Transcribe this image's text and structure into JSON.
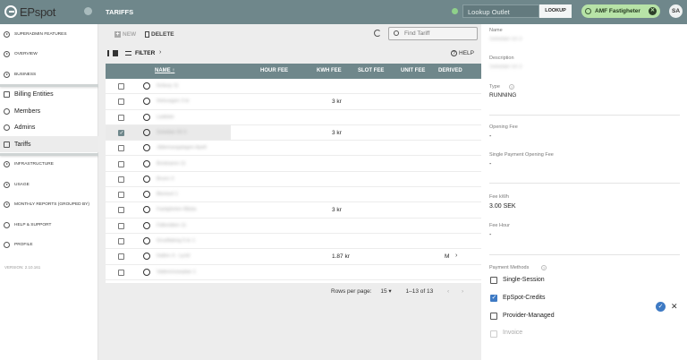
{
  "brand": {
    "name": "EPspot"
  },
  "header": {
    "page_title": "TARIFFS",
    "lookup_placeholder": "Lookup Outlet",
    "lookup_button": "LOOKUP",
    "outlet_chip": "AMF Fastigheter",
    "avatar": "SA"
  },
  "sidebar": {
    "superadmin": "SUPERADMIN FEATURES",
    "overview": "OVERVIEW",
    "business": "BUSINESS",
    "billing": "Billing Entities",
    "members": "Members",
    "admins": "Admins",
    "tariffs": "Tariffs",
    "infrastructure": "INFRASTRUCTURE",
    "usage": "USAGE",
    "monthly": "MONTHLY REPORTS (GROUPED BY)",
    "help": "HELP & SUPPORT",
    "profile": "PROFILE",
    "version": "VERSION: 2.10.161"
  },
  "toolbar": {
    "new": "NEW",
    "delete": "DELETE",
    "search_placeholder": "Find Tariff",
    "filter": "FILTER",
    "help": "HELP"
  },
  "table": {
    "headers": {
      "name": "NAME",
      "hour_fee": "HOUR FEE",
      "kwh_fee": "KWH FEE",
      "slot_fee": "SLOT FEE",
      "unit_fee": "UNIT FEE",
      "derived": "DERIVED"
    },
    "rows": [
      {
        "name": "Grävsy 11",
        "kwh": "",
        "derived": "",
        "selected": false
      },
      {
        "name": "Helsvagen 3 kr",
        "kwh": "3 kr",
        "derived": "",
        "selected": false
      },
      {
        "name": "Laddstn",
        "kwh": "",
        "derived": "",
        "selected": false
      },
      {
        "name": "Solsidan 03 3",
        "kwh": "3 kr",
        "derived": "",
        "selected": true
      },
      {
        "name": "Jättemangalagen Apell",
        "kwh": "",
        "derived": "",
        "selected": false
      },
      {
        "name": "Bredvaren 11",
        "kwh": "",
        "derived": "",
        "selected": false
      },
      {
        "name": "Brunn 3",
        "kwh": "",
        "derived": "",
        "selected": false
      },
      {
        "name": "Blomsvl 1",
        "kwh": "",
        "derived": "",
        "selected": false
      },
      {
        "name": "Fastigheten Båsta",
        "kwh": "3 kr",
        "derived": "",
        "selected": false
      },
      {
        "name": "Fällorätten 11",
        "kwh": "",
        "derived": "",
        "selected": false
      },
      {
        "name": "Grusflaking 5 kr 1",
        "kwh": "",
        "derived": "",
        "selected": false
      },
      {
        "name": "Hallen 4 - Lyckl",
        "kwh": "1.87 kr",
        "derived": "M",
        "selected": false
      },
      {
        "name": "Vattenmoseplan 1",
        "kwh": "",
        "derived": "",
        "selected": false
      }
    ]
  },
  "pager": {
    "rows_label": "Rows per page:",
    "rows_value": "15",
    "range": "1–13 of 13"
  },
  "detail": {
    "name_label": "Name",
    "name_value": "Solsidan 03 3",
    "desc_label": "Description",
    "desc_value": "Solsidan 03 3",
    "type_label": "Type",
    "type_value": "RUNNING",
    "opening_label": "Opening Fee",
    "opening_value": "-",
    "single_opening_label": "Single Payment Opening Fee",
    "single_opening_value": "-",
    "kwh_label": "Fee kWh",
    "kwh_value": "3.00 SEK",
    "hour_label": "Fee Hour",
    "hour_value": "-",
    "pm_label": "Payment Methods",
    "pm_single": "Single-Session",
    "pm_credits": "EpSpot-Credits",
    "pm_provider": "Provider-Managed",
    "pm_invoice": "Invoice"
  },
  "colors": {
    "header": "#6f878b",
    "accent": "#3e7ac4",
    "chip": "#b7e3a7"
  }
}
